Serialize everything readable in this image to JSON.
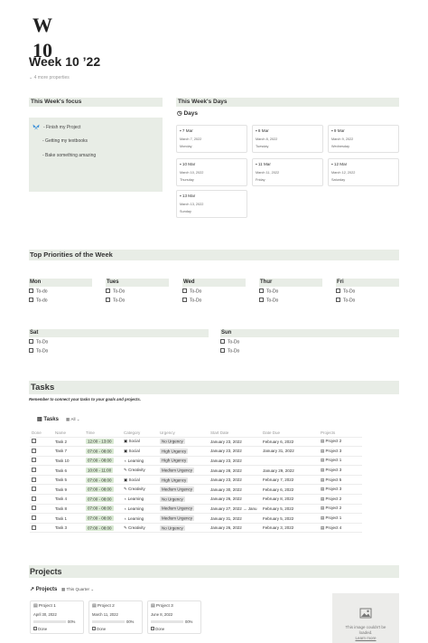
{
  "logo": "W 10",
  "page": {
    "title": "Week 10 ’22",
    "properties_link": "4 more properties"
  },
  "focus": {
    "heading": "This Week's focus",
    "items": [
      "- Finish my Project",
      "- Getting my textbooks",
      "- Bake something amazing"
    ]
  },
  "days": {
    "heading": "This Week's Days",
    "view_label": "Days",
    "cards": [
      {
        "name": "7 Mar",
        "date": "March 7, 2022",
        "weekday": "Monday"
      },
      {
        "name": "8 Mar",
        "date": "March 8, 2022",
        "weekday": "Tuesday"
      },
      {
        "name": "9 Mar",
        "date": "March 9, 2022",
        "weekday": "Wednesday"
      },
      {
        "name": "10 Mar",
        "date": "March 10, 2022",
        "weekday": "Thursday"
      },
      {
        "name": "11 Mar",
        "date": "March 11, 2022",
        "weekday": "Friday"
      },
      {
        "name": "12 Mar",
        "date": "March 12, 2022",
        "weekday": "Saturday"
      },
      {
        "name": "13 Mar",
        "date": "March 13, 2022",
        "weekday": "Sunday"
      }
    ]
  },
  "priorities": {
    "heading": "Top Priorities of the Week",
    "columns": [
      {
        "day": "Mon",
        "todos": [
          "To-do",
          "To-do"
        ]
      },
      {
        "day": "Tues",
        "todos": [
          "To-Do",
          "To-Do"
        ]
      },
      {
        "day": "Wed",
        "todos": [
          "To-Do",
          "To-Do"
        ]
      },
      {
        "day": "Thur",
        "todos": [
          "To-Do",
          "To-Do"
        ]
      },
      {
        "day": "Fri",
        "todos": [
          "To-Do",
          "To-Do"
        ]
      },
      {
        "day": "Sat",
        "todos": [
          "To-Do",
          "To-Do"
        ]
      },
      {
        "day": "Sun",
        "todos": [
          "To-Do",
          "To-Do"
        ]
      }
    ]
  },
  "tasks": {
    "heading": "Tasks",
    "subtitle": "Remember to connect your tasks to your goals and projects.",
    "view_title": "Tasks",
    "view_filter": "All",
    "columns": [
      "Done",
      "Name",
      "Time",
      "Category",
      "Urgency",
      "Start Date",
      "Date Due",
      "Projects"
    ],
    "rows": [
      {
        "name": "Task 2",
        "time": "12:00 - 13:00",
        "category": "Social",
        "urgency": "No Urgency",
        "start": "January 23, 2022",
        "due": "February 6, 2022",
        "project": "Project 2"
      },
      {
        "name": "Task 7",
        "time": "07:00 - 08:00",
        "category": "Social",
        "urgency": "High Urgency",
        "start": "January 23, 2022",
        "due": "January 31, 2022",
        "project": "Project 3"
      },
      {
        "name": "Task 10",
        "time": "07:00 - 08:00",
        "category": "Learning",
        "urgency": "High Urgency",
        "start": "January 23, 2022",
        "due": "",
        "project": "Project 1"
      },
      {
        "name": "Task 6",
        "time": "10:00 - 11:00",
        "category": "Creativity",
        "urgency": "Medium Urgency",
        "start": "January 28, 2022",
        "due": "January 29, 2022",
        "project": "Project 3"
      },
      {
        "name": "Task 5",
        "time": "07:00 - 08:00",
        "category": "Social",
        "urgency": "High Urgency",
        "start": "January 23, 2022",
        "due": "February 7, 2022",
        "project": "Project 5"
      },
      {
        "name": "Task 9",
        "time": "07:00 - 08:00",
        "category": "Creativity",
        "urgency": "Medium Urgency",
        "start": "January 30, 2022",
        "due": "February 6, 2022",
        "project": "Project 3"
      },
      {
        "name": "Task 4",
        "time": "07:00 - 08:00",
        "category": "Learning",
        "urgency": "No Urgency",
        "start": "January 26, 2022",
        "due": "February 8, 2022",
        "project": "Project 2"
      },
      {
        "name": "Task 8",
        "time": "07:00 - 08:00",
        "category": "Learning",
        "urgency": "Medium Urgency",
        "start": "January 27, 2022 → Janu",
        "due": "February 5, 2022",
        "project": "Project 2"
      },
      {
        "name": "Task 1",
        "time": "07:00 - 08:00",
        "category": "Learning",
        "urgency": "Medium Urgency",
        "start": "January 31, 2022",
        "due": "February 5, 2022",
        "project": "Project 1"
      },
      {
        "name": "Task 3",
        "time": "07:00 - 08:00",
        "category": "Creativity",
        "urgency": "No Urgency",
        "start": "January 26, 2022",
        "due": "February 3, 2022",
        "project": "Project 4"
      }
    ]
  },
  "projects": {
    "heading": "Projects",
    "view_title": "Projects",
    "view_filter": "This Quarter",
    "cards": [
      {
        "name": "Project 1",
        "date": "April 30, 2022",
        "progress": 0.0,
        "progress_label": "00%",
        "done": "Done"
      },
      {
        "name": "Project 2",
        "date": "March 11, 2022",
        "progress": 0.0,
        "progress_label": "00%",
        "done": "Done"
      },
      {
        "name": "Project 3",
        "date": "June 8, 2022",
        "progress": 0.0,
        "progress_label": "00%",
        "done": "Done"
      }
    ],
    "image_error": "This image couldn't be loaded.",
    "image_error_link": "Learn more"
  },
  "colors": {
    "section_bg": "#e8ede6",
    "time_pill": "#d9ead3",
    "urgency_pill": "#e4e4e4",
    "butterfly": "#3a8fd8"
  },
  "icons": [
    "butterfly-icon",
    "clock-icon",
    "calendar-icon",
    "grid-icon",
    "page-icon",
    "checkbox-icon",
    "image-icon",
    "arrow-icon"
  ]
}
